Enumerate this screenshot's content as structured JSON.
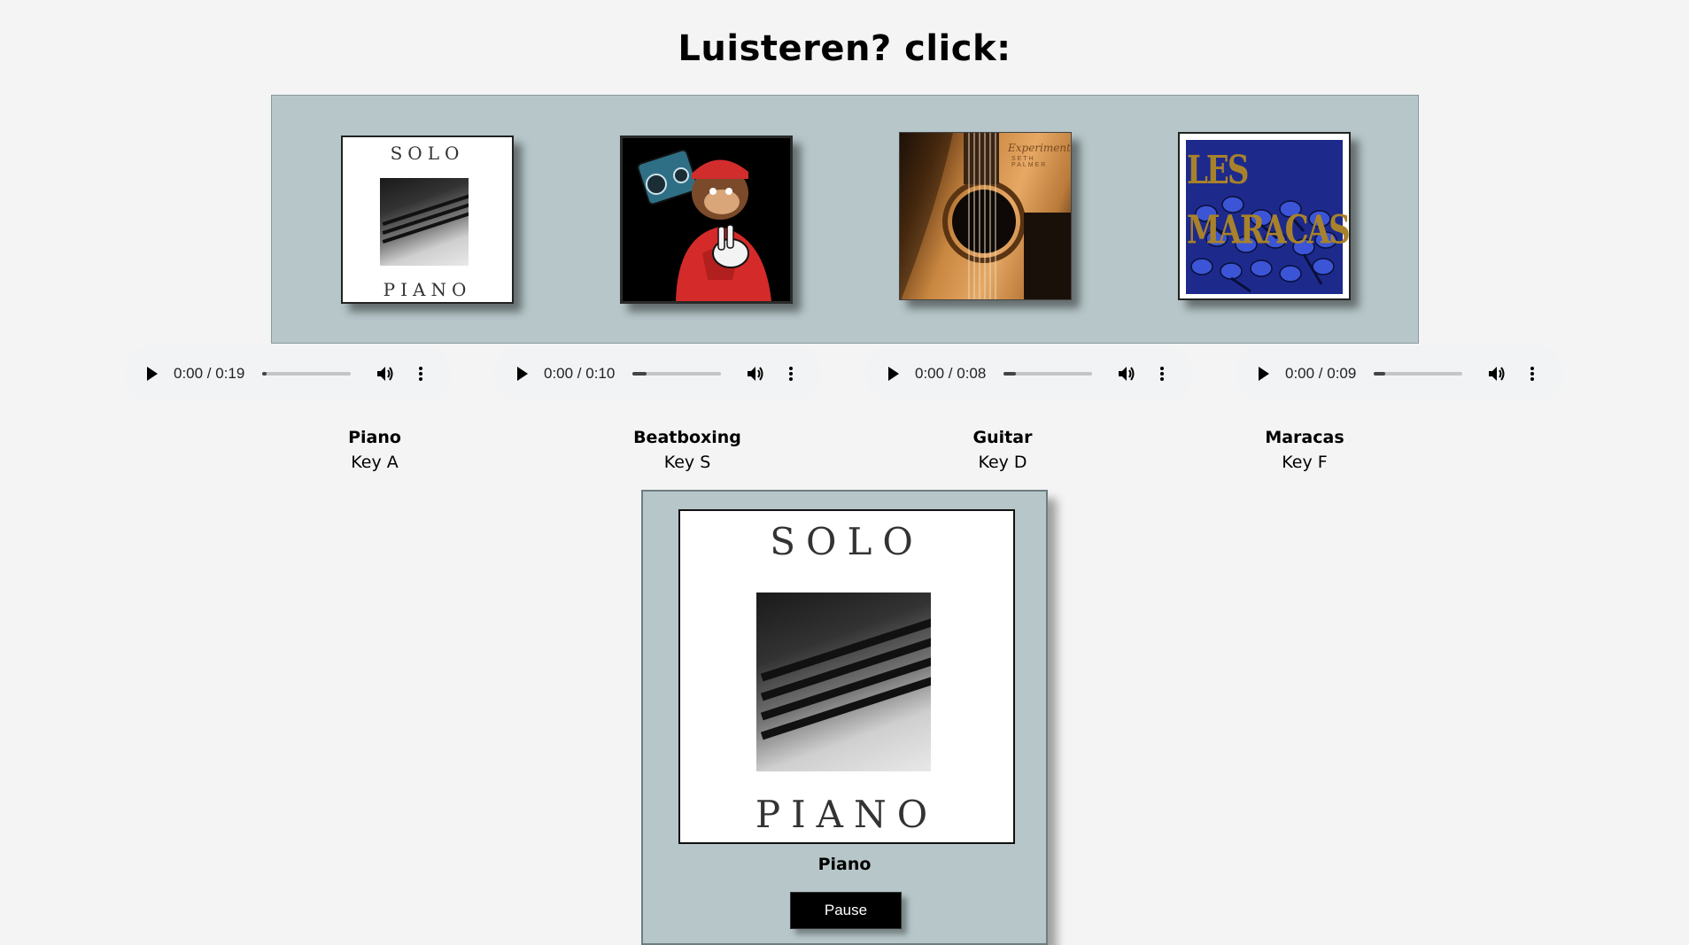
{
  "page": {
    "title": "Luisteren? click:"
  },
  "covers": [
    {
      "name": "Piano",
      "top_text": "SOLO",
      "bottom_text": "PIANO"
    },
    {
      "name": "Beatboxing"
    },
    {
      "name": "Guitar",
      "script_text": "Experiments",
      "sub_text": "SETH PALMER"
    },
    {
      "name": "Maracas",
      "title_text": "LES MARACAS"
    }
  ],
  "players": [
    {
      "time": "0:00 / 0:19",
      "progress": 0.05
    },
    {
      "time": "0:00 / 0:10",
      "progress": 0.16
    },
    {
      "time": "0:00 / 0:08",
      "progress": 0.14
    },
    {
      "time": "0:00 / 0:09",
      "progress": 0.13
    }
  ],
  "instruments": [
    {
      "name": "Piano",
      "key": "Key A"
    },
    {
      "name": "Beatboxing",
      "key": "Key S"
    },
    {
      "name": "Guitar",
      "key": "Key D"
    },
    {
      "name": "Maracas",
      "key": "Key F"
    }
  ],
  "now_playing": {
    "cover_top": "SOLO",
    "cover_bottom": "PIANO",
    "name": "Piano",
    "button_label": "Pause"
  },
  "colors": {
    "panel_bg": "#b6c6c9",
    "page_bg": "#f4f4f4"
  }
}
